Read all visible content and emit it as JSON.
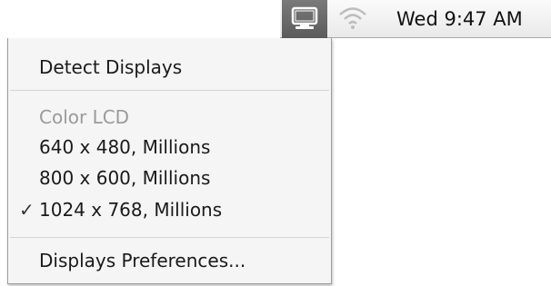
{
  "menubar": {
    "displays_icon": "display-monitor-icon",
    "airport_icon": "wifi-icon",
    "clock": "Wed 9:47 AM"
  },
  "menu": {
    "detect": "Detect Displays",
    "section_header": "Color LCD",
    "resolutions": [
      {
        "label": "640 x 480, Millions",
        "checked": false
      },
      {
        "label": "800 x 600, Millions",
        "checked": false
      },
      {
        "label": "1024 x 768, Millions",
        "checked": true
      }
    ],
    "check_glyph": "✓",
    "preferences": "Displays Preferences..."
  }
}
